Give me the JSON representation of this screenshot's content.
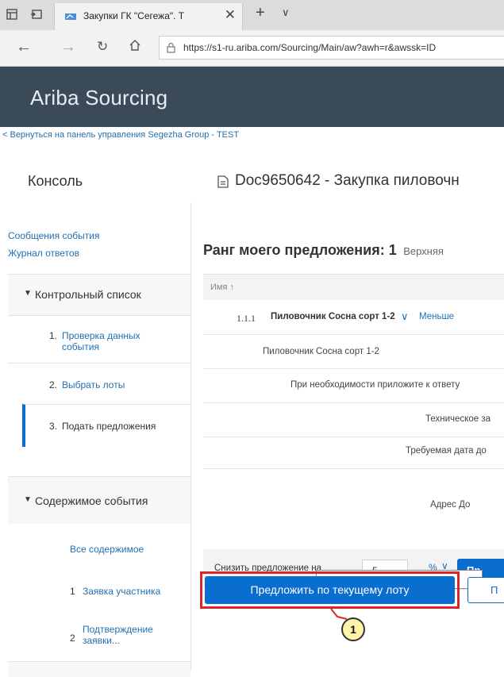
{
  "browser": {
    "tab_title": "Закупки ГК \"Сегежа\". Т",
    "url": "https://s1-ru.ariba.com/Sourcing/Main/aw?awh=r&awssk=ID"
  },
  "header": {
    "app_title": "Ariba Sourcing"
  },
  "breadcrumb": {
    "back_link": "< Вернуться на панель управления Segezha Group - TEST"
  },
  "console": {
    "title": "Консоль",
    "doc_title": "Doc9650642 - Закупка пиловочн"
  },
  "sidebar": {
    "links": [
      "Сообщения события",
      "Журнал ответов"
    ],
    "checklist": {
      "title": "Контрольный список",
      "items": [
        {
          "num": "1.",
          "label": "Проверка данных события"
        },
        {
          "num": "2.",
          "label": "Выбрать лоты"
        },
        {
          "num": "3.",
          "label": "Подать предложения"
        }
      ]
    },
    "content": {
      "title": "Содержимое события",
      "all": "Все содержимое",
      "items": [
        {
          "num": "1",
          "label": "Заявка участника"
        },
        {
          "num": "2",
          "label": "Подтверждение заявки..."
        }
      ]
    }
  },
  "main": {
    "rank_label": "Ранг моего предложения: 1",
    "rank_sub": "Верхняя",
    "col_name": "Имя ↑",
    "lot": {
      "num": "1.1.1",
      "name": "Пиловочник Сосна сорт 1-2",
      "less": "Меньше"
    },
    "rows": [
      "Пиловочник Сосна сорт 1-2",
      "При необходимости приложите к ответу",
      "Техническое за",
      "Требуемая дата до",
      "Адрес До"
    ],
    "bid": {
      "label": "Снизить предложение на",
      "value": "5",
      "unit": "%",
      "button": "Пр"
    },
    "tooltip": "Предложить по текущему лоту",
    "primary_button": "Предложить по текущему лоту",
    "secondary_button": "П",
    "callout": "1"
  },
  "colors": {
    "header_bg": "#3b4a59",
    "primary": "#0a6ed1",
    "link": "#1f6fb2",
    "highlight": "#d9262b",
    "callout_fill": "#fff3a8"
  }
}
